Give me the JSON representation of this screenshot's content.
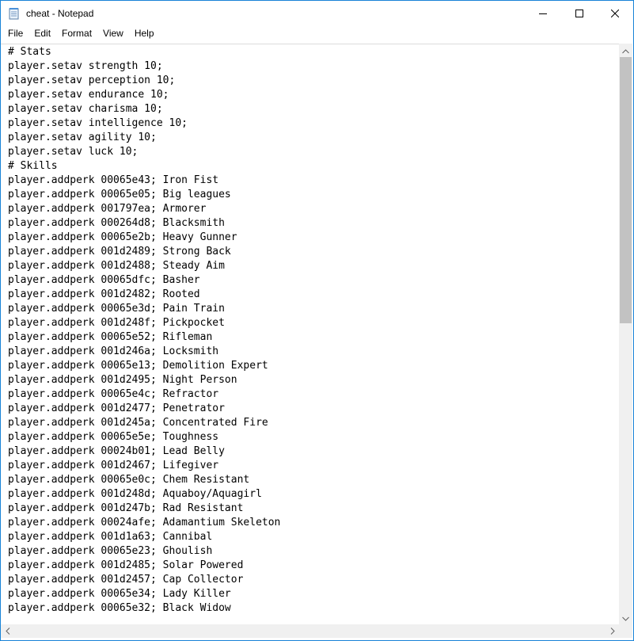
{
  "window": {
    "title": "cheat - Notepad",
    "accent_color": "#1883d7",
    "icon": "notepad-icon",
    "controls": {
      "minimize_icon": "minimize-icon",
      "maximize_icon": "maximize-icon",
      "close_icon": "close-icon"
    }
  },
  "menu": {
    "items": [
      {
        "label": "File"
      },
      {
        "label": "Edit"
      },
      {
        "label": "Format"
      },
      {
        "label": "View"
      },
      {
        "label": "Help"
      }
    ]
  },
  "editor": {
    "lines": [
      "# Stats",
      "player.setav strength 10;",
      "player.setav perception 10;",
      "player.setav endurance 10;",
      "player.setav charisma 10;",
      "player.setav intelligence 10;",
      "player.setav agility 10;",
      "player.setav luck 10;",
      "# Skills",
      "player.addperk 00065e43; Iron Fist",
      "player.addperk 00065e05; Big leagues",
      "player.addperk 001797ea; Armorer",
      "player.addperk 000264d8; Blacksmith",
      "player.addperk 00065e2b; Heavy Gunner",
      "player.addperk 001d2489; Strong Back",
      "player.addperk 001d2488; Steady Aim",
      "player.addperk 00065dfc; Basher",
      "player.addperk 001d2482; Rooted",
      "player.addperk 00065e3d; Pain Train",
      "player.addperk 001d248f; Pickpocket",
      "player.addperk 00065e52; Rifleman",
      "player.addperk 001d246a; Locksmith",
      "player.addperk 00065e13; Demolition Expert",
      "player.addperk 001d2495; Night Person",
      "player.addperk 00065e4c; Refractor",
      "player.addperk 001d2477; Penetrator",
      "player.addperk 001d245a; Concentrated Fire",
      "player.addperk 00065e5e; Toughness",
      "player.addperk 00024b01; Lead Belly",
      "player.addperk 001d2467; Lifegiver",
      "player.addperk 00065e0c; Chem Resistant",
      "player.addperk 001d248d; Aquaboy/Aquagirl",
      "player.addperk 001d247b; Rad Resistant",
      "player.addperk 00024afe; Adamantium Skeleton",
      "player.addperk 001d1a63; Cannibal",
      "player.addperk 00065e23; Ghoulish",
      "player.addperk 001d2485; Solar Powered",
      "player.addperk 001d2457; Cap Collector",
      "player.addperk 00065e34; Lady Killer",
      "player.addperk 00065e32; Black Widow"
    ]
  },
  "scrollbars": {
    "vertical_position_fraction": 0.0,
    "vertical_visible_fraction": 0.48
  }
}
